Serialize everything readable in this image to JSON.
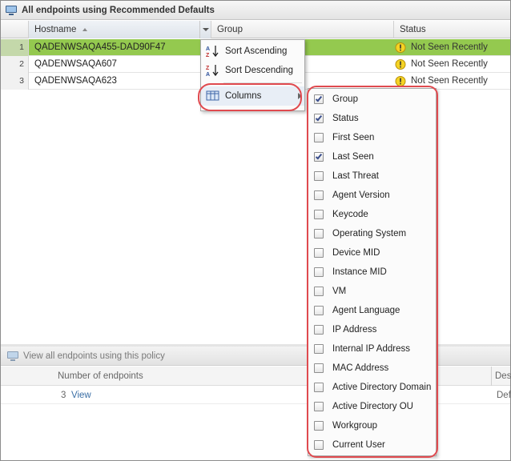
{
  "window": {
    "title": "All endpoints using Recommended Defaults"
  },
  "grid": {
    "columns": {
      "hostname": "Hostname",
      "group": "Group",
      "status": "Status"
    },
    "rows": [
      {
        "num": "1",
        "hostname": "QADENWSAQA455-DAD90F47",
        "status": "Not Seen Recently",
        "selected": true
      },
      {
        "num": "2",
        "hostname": "QADENWSAQA607",
        "status": "Not Seen Recently",
        "selected": false
      },
      {
        "num": "3",
        "hostname": "QADENWSAQA623",
        "status": "Not Seen Recently",
        "selected": false
      }
    ]
  },
  "context_menu": {
    "sort_ascending": "Sort Ascending",
    "sort_descending": "Sort Descending",
    "columns": "Columns"
  },
  "columns_submenu": [
    {
      "label": "Group",
      "checked": true
    },
    {
      "label": "Status",
      "checked": true
    },
    {
      "label": "First Seen",
      "checked": false
    },
    {
      "label": "Last Seen",
      "checked": true
    },
    {
      "label": "Last Threat",
      "checked": false
    },
    {
      "label": "Agent Version",
      "checked": false
    },
    {
      "label": "Keycode",
      "checked": false
    },
    {
      "label": "Operating System",
      "checked": false
    },
    {
      "label": "Device MID",
      "checked": false
    },
    {
      "label": "Instance MID",
      "checked": false
    },
    {
      "label": "VM",
      "checked": false
    },
    {
      "label": "Agent Language",
      "checked": false
    },
    {
      "label": "IP Address",
      "checked": false
    },
    {
      "label": "Internal IP Address",
      "checked": false
    },
    {
      "label": "MAC Address",
      "checked": false
    },
    {
      "label": "Active Directory Domain",
      "checked": false
    },
    {
      "label": "Active Directory OU",
      "checked": false
    },
    {
      "label": "Workgroup",
      "checked": false
    },
    {
      "label": "Current User",
      "checked": false
    }
  ],
  "lower_panel": {
    "title": "View all endpoints using this policy",
    "col_number": "Number of endpoints",
    "col_desc_partial": "Des",
    "count": "3",
    "view_link": "View",
    "desc_partial": "Def"
  },
  "colors": {
    "selected_row": "#94c94f",
    "highlight_outline": "#e04a4f",
    "link": "#3a6ea5"
  }
}
